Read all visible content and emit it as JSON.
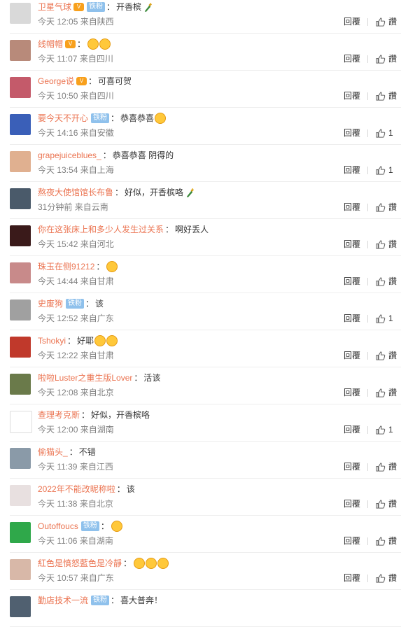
{
  "comments": [
    {
      "name": "卫星气球",
      "vip": "V",
      "badge": "铁粉",
      "text": "开香槟",
      "emoji": "bottle",
      "time": "今天 12:05",
      "location": "来自陕西",
      "reply": "回覆",
      "likes": "讚",
      "avatar_color": "#d9d9d9"
    },
    {
      "name": "线帽帽",
      "vip": "V",
      "badge": "",
      "text": "",
      "emoji": "faces2",
      "time": "今天 11:07",
      "location": "来自四川",
      "reply": "回覆",
      "likes": "讚",
      "avatar_color": "#b88a7a"
    },
    {
      "name": "George说",
      "vip": "V",
      "badge": "",
      "text": "可喜可贺",
      "emoji": "",
      "time": "今天 10:50",
      "location": "来自四川",
      "reply": "回覆",
      "likes": "讚",
      "avatar_color": "#c45a6a"
    },
    {
      "name": "要今天不开心",
      "vip": "",
      "badge": "铁粉",
      "text": "恭喜恭喜",
      "emoji": "face1",
      "time": "今天 14:16",
      "location": "来自安徽",
      "reply": "回覆",
      "likes": "1",
      "avatar_color": "#3a5fb8"
    },
    {
      "name": "grapejuiceblues_",
      "vip": "",
      "badge": "",
      "text": "恭喜恭喜 阴得的",
      "emoji": "",
      "time": "今天 13:54",
      "location": "来自上海",
      "reply": "回覆",
      "likes": "1",
      "avatar_color": "#e0b090"
    },
    {
      "name": "熬夜大使馆馆长布鲁",
      "vip": "",
      "badge": "",
      "text": "好似，开香槟咯",
      "emoji": "bottle",
      "time": "31分钟前",
      "location": "来自云南",
      "reply": "回覆",
      "likes": "讚",
      "avatar_color": "#4a5a6a"
    },
    {
      "name": "你在这张床上和多少人发生过关系",
      "vip": "",
      "badge": "",
      "text": "啊好丢人",
      "emoji": "",
      "time": "今天 15:42",
      "location": "来自河北",
      "reply": "回覆",
      "likes": "讚",
      "avatar_color": "#3a1a1a"
    },
    {
      "name": "珠玉在侧91212",
      "vip": "",
      "badge": "",
      "text": "",
      "emoji": "face1",
      "time": "今天 14:44",
      "location": "来自甘肃",
      "reply": "回覆",
      "likes": "讚",
      "avatar_color": "#c88a8a"
    },
    {
      "name": "史废狗",
      "vip": "",
      "badge": "铁粉",
      "text": "该",
      "emoji": "",
      "time": "今天 12:52",
      "location": "来自广东",
      "reply": "回覆",
      "likes": "1",
      "avatar_color": "#a0a0a0"
    },
    {
      "name": "Tshokyi",
      "vip": "",
      "badge": "",
      "text": "好耶",
      "emoji": "faces2",
      "time": "今天 12:22",
      "location": "来自甘肃",
      "reply": "回覆",
      "likes": "讚",
      "avatar_color": "#c0392b"
    },
    {
      "name": "啦啦Luster之重生版Lover",
      "vip": "",
      "badge": "",
      "text": "活该",
      "emoji": "",
      "time": "今天 12:08",
      "location": "来自北京",
      "reply": "回覆",
      "likes": "讚",
      "avatar_color": "#6a7a4a"
    },
    {
      "name": "查理考克斯",
      "vip": "",
      "badge": "",
      "text": "好似，开香槟咯",
      "emoji": "",
      "time": "今天 12:00",
      "location": "来自湖南",
      "reply": "回覆",
      "likes": "1",
      "avatar_color": "#ffffff"
    },
    {
      "name": "偷猫头_",
      "vip": "",
      "badge": "",
      "text": "不错",
      "emoji": "",
      "time": "今天 11:39",
      "location": "来自江西",
      "reply": "回覆",
      "likes": "讚",
      "avatar_color": "#8a9aa8"
    },
    {
      "name": "2022年不能改昵称啦",
      "vip": "",
      "badge": "",
      "text": "该",
      "emoji": "",
      "time": "今天 11:38",
      "location": "来自北京",
      "reply": "回覆",
      "likes": "讚",
      "avatar_color": "#e8e0e0"
    },
    {
      "name": "Outoffoucs",
      "vip": "",
      "badge": "铁粉",
      "text": "",
      "emoji": "face1",
      "time": "今天 11:06",
      "location": "来自湖南",
      "reply": "回覆",
      "likes": "讚",
      "avatar_color": "#2fa84a"
    },
    {
      "name": "紅色是憤怒藍色是冷靜",
      "vip": "",
      "badge": "",
      "text": "",
      "emoji": "faces3",
      "time": "今天 10:57",
      "location": "来自广东",
      "reply": "回覆",
      "likes": "讚",
      "avatar_color": "#d8b8a8"
    },
    {
      "name": "勤店技术一流",
      "vip": "",
      "badge": "铁粉",
      "text": "喜大普奔！",
      "emoji": "",
      "time": "",
      "location": "",
      "reply": "",
      "likes": "",
      "avatar_color": "#506070"
    }
  ]
}
